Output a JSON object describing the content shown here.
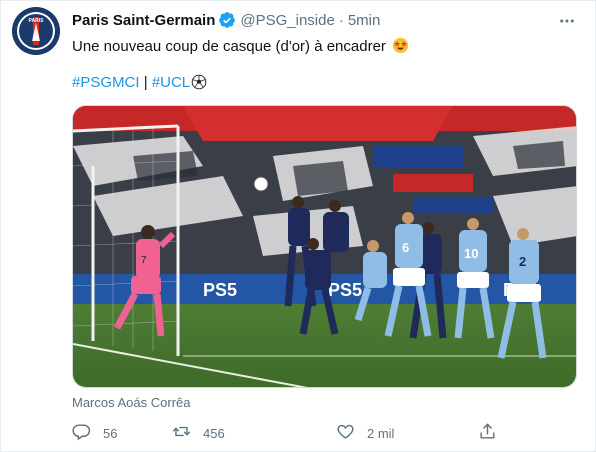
{
  "tweet": {
    "display_name": "Paris Saint-Germain",
    "handle": "@PSG_inside",
    "separator": "·",
    "time": "5min",
    "text": "Une nouveau coup de casque (d'or) à encadrer",
    "hashtags": [
      "#PSGMCI",
      "#UCL"
    ],
    "hashtag_separator": "|",
    "photo_credit": "Marcos Aoás Corrêa",
    "avatar_text": "PARIS",
    "reply_count": "56",
    "retweet_count": "456",
    "like_count": "2 mil"
  },
  "media": {
    "billboard_text": "PS5",
    "player_numbers": [
      "6",
      "10",
      "2",
      "7"
    ]
  },
  "colors": {
    "link": "#1b95e0",
    "secondary": "#5b7083",
    "verified": "#1da1f2",
    "psg_navy": "#1b3a6b"
  },
  "icons": {
    "more": "more-horizontal-icon",
    "verified": "verified-badge-icon",
    "emoji": "star-struck-emoji-icon",
    "ball": "soccer-ball-icon",
    "reply": "reply-icon",
    "retweet": "retweet-icon",
    "like": "heart-icon",
    "share": "share-icon"
  }
}
